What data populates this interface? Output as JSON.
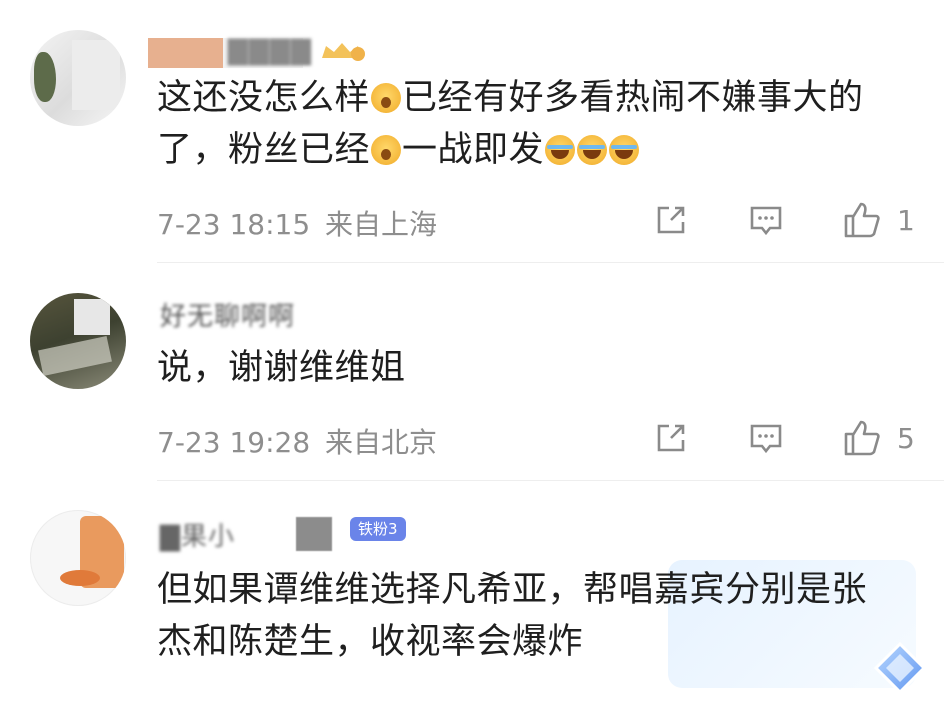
{
  "comments": [
    {
      "username": "▇▇▇▇",
      "text_parts": [
        "这还没怎么样",
        "已经有好多看热闹不嫌事大的了，粉丝已经",
        "一战即发"
      ],
      "time": "7-23 18:15",
      "location": "来自上海",
      "likes": "1"
    },
    {
      "username": "好无聊啊啊",
      "text": "说，谢谢维维姐",
      "time": "7-23 19:28",
      "location": "来自北京",
      "likes": "5"
    },
    {
      "username": "▇果小",
      "badge": "铁粉3",
      "text": "但如果谭维维选择凡希亚，帮唱嘉宾分别是张杰和陈楚生，收视率会爆炸"
    }
  ],
  "icons": {
    "share": "share-icon",
    "comment": "comment-icon",
    "like": "thumbs-up-icon",
    "emoji_open": "surprised-emoji-icon",
    "emoji_laugh": "laugh-tears-emoji-icon",
    "vip": "crown-icon"
  },
  "colors": {
    "text": "#1f1f1f",
    "meta": "#8e8e8e",
    "badge": "#6a84e9"
  }
}
